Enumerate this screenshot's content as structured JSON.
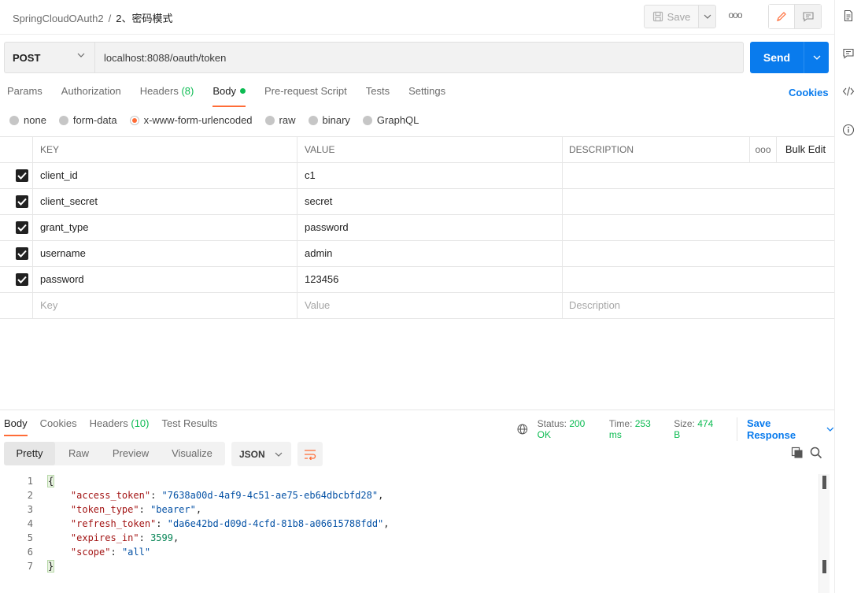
{
  "header": {
    "collection": "SpringCloudOAuth2",
    "separator": "/",
    "request_name": "2、密码模式",
    "save_label": "Save",
    "more_label": "ooo"
  },
  "request": {
    "method": "POST",
    "url": "localhost:8088/oauth/token",
    "send_label": "Send"
  },
  "tabs": [
    {
      "label": "Params"
    },
    {
      "label": "Authorization"
    },
    {
      "label": "Headers",
      "count": "(8)"
    },
    {
      "label": "Body",
      "active": true
    },
    {
      "label": "Pre-request Script"
    },
    {
      "label": "Tests"
    },
    {
      "label": "Settings"
    }
  ],
  "cookies_label": "Cookies",
  "body_types": [
    {
      "label": "none"
    },
    {
      "label": "form-data"
    },
    {
      "label": "x-www-form-urlencoded",
      "selected": true
    },
    {
      "label": "raw"
    },
    {
      "label": "binary"
    },
    {
      "label": "GraphQL"
    }
  ],
  "params_table": {
    "headers": {
      "key": "KEY",
      "value": "VALUE",
      "description": "DESCRIPTION",
      "more": "ooo",
      "bulk_edit": "Bulk Edit"
    },
    "rows": [
      {
        "key": "client_id",
        "value": "c1",
        "description": "",
        "checked": true
      },
      {
        "key": "client_secret",
        "value": "secret",
        "description": "",
        "checked": true
      },
      {
        "key": "grant_type",
        "value": "password",
        "description": "",
        "checked": true
      },
      {
        "key": "username",
        "value": "admin",
        "description": "",
        "checked": true
      },
      {
        "key": "password",
        "value": "123456",
        "description": "",
        "checked": true
      }
    ],
    "placeholder": {
      "key": "Key",
      "value": "Value",
      "description": "Description"
    }
  },
  "response": {
    "tabs": [
      {
        "label": "Body",
        "active": true
      },
      {
        "label": "Cookies"
      },
      {
        "label": "Headers",
        "count": "(10)"
      },
      {
        "label": "Test Results"
      }
    ],
    "status_label": "Status:",
    "status_value": "200 OK",
    "time_label": "Time:",
    "time_value": "253 ms",
    "size_label": "Size:",
    "size_value": "474 B",
    "save_response_label": "Save Response",
    "views": [
      "Pretty",
      "Raw",
      "Preview",
      "Visualize"
    ],
    "format": "JSON",
    "body_lines": [
      {
        "n": "1",
        "text": "{"
      },
      {
        "n": "2",
        "key": "\"access_token\"",
        "value": "\"7638a00d-4af9-4c51-ae75-eb64dbcbfd28\"",
        "end": ","
      },
      {
        "n": "3",
        "key": "\"token_type\"",
        "value": "\"bearer\"",
        "end": ","
      },
      {
        "n": "4",
        "key": "\"refresh_token\"",
        "value": "\"da6e42bd-d09d-4cfd-81b8-a06615788fdd\"",
        "end": ","
      },
      {
        "n": "5",
        "key": "\"expires_in\"",
        "num": "3599",
        "end": ","
      },
      {
        "n": "6",
        "key": "\"scope\"",
        "value": "\"all\"",
        "end": ""
      },
      {
        "n": "7",
        "text": "}"
      }
    ]
  },
  "colors": {
    "accent_orange": "#ff6c37",
    "send_blue": "#097bed",
    "success_green": "#0cbb52"
  }
}
